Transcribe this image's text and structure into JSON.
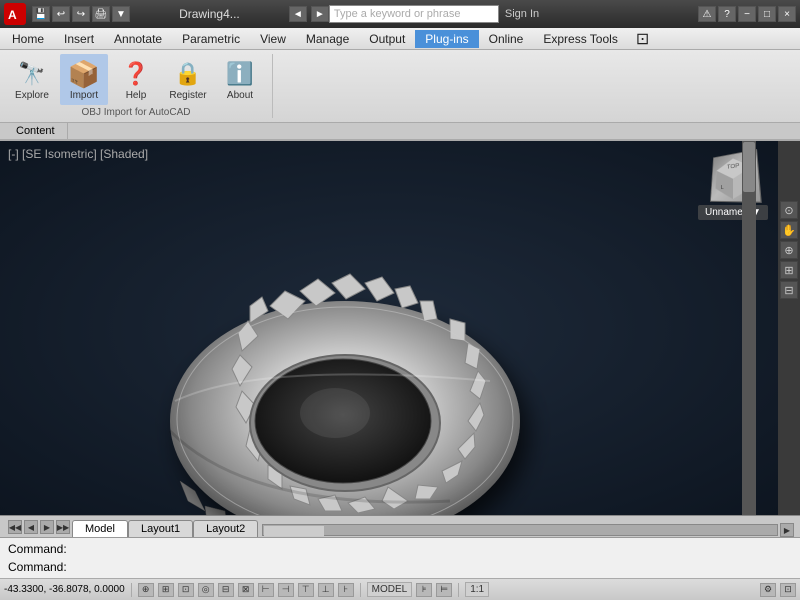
{
  "titlebar": {
    "app_icon": "A",
    "drawing_title": "Drawing4...",
    "search_placeholder": "Type a keyword or phrase",
    "sign_in_label": "Sign In",
    "minimize_label": "−",
    "restore_label": "□",
    "close_label": "×",
    "app_min": "−",
    "app_restore": "□",
    "app_close": "×"
  },
  "menubar": {
    "items": [
      "Home",
      "Insert",
      "Annotate",
      "Parametric",
      "View",
      "Manage",
      "Output",
      "Plug-ins",
      "Online",
      "Express Tools"
    ],
    "active": "Plug-ins"
  },
  "ribbon": {
    "group_label": "OBJ Import for AutoCAD",
    "buttons": [
      {
        "label": "Explore",
        "icon": "🔭"
      },
      {
        "label": "Import",
        "icon": "📦"
      },
      {
        "label": "Help",
        "icon": "❓"
      },
      {
        "label": "Register",
        "icon": "🔒"
      },
      {
        "label": "About",
        "icon": "ℹ️"
      }
    ],
    "content_label": "Content"
  },
  "viewport": {
    "label": "[-] [SE Isometric] [Shaded]",
    "background": "#0d1520"
  },
  "viewcube": {
    "label": "Unnamed",
    "arrow": "▼"
  },
  "tabs": {
    "nav": [
      "◄◄",
      "◄",
      "►",
      "►►"
    ],
    "items": [
      "Model",
      "Layout1",
      "Layout2"
    ]
  },
  "commands": [
    "Command:",
    "Command:"
  ],
  "statusbar": {
    "coords": "-43.3300, -36.8078, 0.0000",
    "model_label": "MODEL",
    "scale_label": "1:1",
    "icons": [
      "⊕",
      "⊞",
      "◎",
      "⊟",
      "⊠",
      "⊡",
      "⊢",
      "⊣",
      "⊤",
      "⊥",
      "⊦",
      "⊧",
      "⊨"
    ]
  }
}
